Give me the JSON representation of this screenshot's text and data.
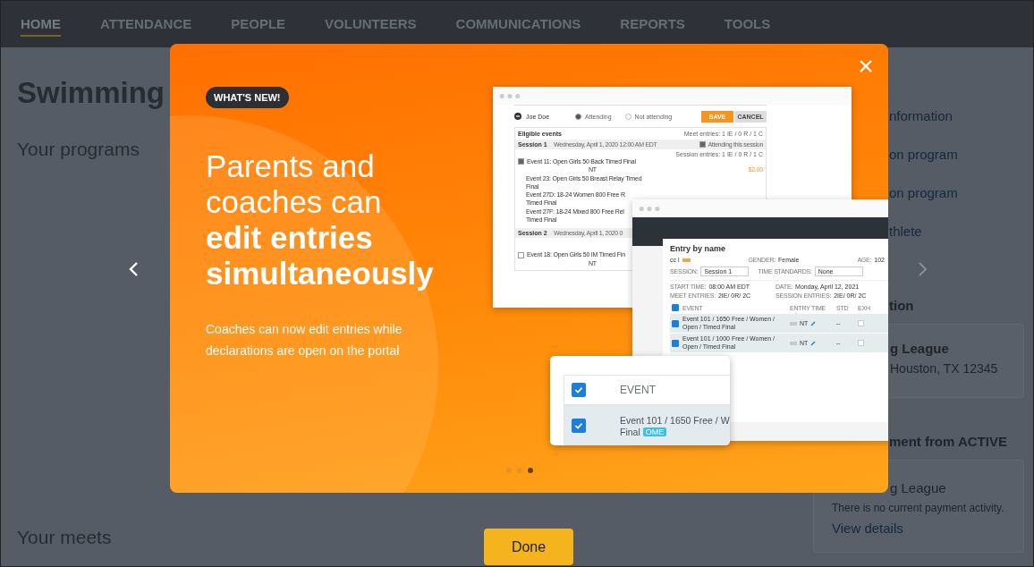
{
  "nav": [
    {
      "label": "HOME",
      "selected": true
    },
    {
      "label": "ATTENDANCE",
      "selected": false
    },
    {
      "label": "PEOPLE",
      "selected": false
    },
    {
      "label": "VOLUNTEERS",
      "selected": false
    },
    {
      "label": "COMMUNICATIONS",
      "selected": false
    },
    {
      "label": "REPORTS",
      "selected": false
    },
    {
      "label": "TOOLS",
      "selected": false
    }
  ],
  "page": {
    "title": "Swimming",
    "programs_heading": "Your programs",
    "meets_heading": "Your meets"
  },
  "sidebar": {
    "links": [
      "nformation",
      "on program",
      "on program",
      "thlete"
    ],
    "location_heading": "tion",
    "location_card": {
      "name": "g League",
      "address": "Houston, TX 12345"
    },
    "payment_heading": "ment from ACTIVE",
    "payment_card": {
      "name": "g League",
      "status": "There is no current payment activity.",
      "link": "View details"
    }
  },
  "modal": {
    "badge": "WHAT'S NEW!",
    "headline": "Parents and coaches can **edit entries simultaneously**",
    "description": "Coaches can now edit entries while declarations are open on the portal",
    "slides": [
      {
        "selected": false
      },
      {
        "selected": false
      },
      {
        "selected": true
      }
    ],
    "done_label": "Done"
  },
  "declaration_mockup": {
    "athlete": "Joe Doe",
    "options": [
      {
        "label": "Attending",
        "selected": true
      },
      {
        "label": "Not attending",
        "selected": false
      }
    ],
    "save_label": "SAVE",
    "cancel_label": "CANCEL",
    "events_title": "Eligible events",
    "meet_entries": "Meet entries: 1 IE / 0 R / 1 C",
    "sessions": [
      {
        "name": "Session 1",
        "date": "Wednesday, April 1, 2020 12:00 AM EDT",
        "attending_label": "Attending this session",
        "attending": true,
        "entries": "Session entries: 1 IE / 0 R / 1 C",
        "events": [
          {
            "kind": "checkbox",
            "label": "Event 11: Open Girls 50 Back Timed Final",
            "checked": true,
            "time": "NT",
            "fee": "$2.00"
          },
          {
            "kind": "plain",
            "label": "Event 23: Open Girls 50 Breast Relay Timed",
            "line2": "Final"
          },
          {
            "kind": "plain",
            "label": "Event 27D: 18-24 Women 800 Free R",
            "line2": "Timed Final"
          },
          {
            "kind": "plain",
            "label": "Event 27F: 18-24 Mixed 800 Free Rel",
            "line2": "Timed Final"
          }
        ]
      },
      {
        "name": "Session 2",
        "date": "Wednesday, April 1, 2020 0",
        "events": [
          {
            "kind": "checkbox",
            "label": "Event 18: Open Girls 50 IM Timed Fin",
            "checked": false,
            "time": "NT"
          }
        ]
      }
    ]
  },
  "entry_mockup": {
    "title": "Entry by name",
    "athlete": "cc l",
    "gender_label": "GENDER:",
    "gender": "Female",
    "age_label": "AGE:",
    "age": "102",
    "selects": [
      {
        "label": "SESSION:",
        "value": "Session 1"
      },
      {
        "label": "TIME STANDARDS:",
        "value": "None"
      }
    ],
    "info": [
      {
        "label": "START TIME:",
        "value": "08:00 AM EDT"
      },
      {
        "label": "DATE:",
        "value": "Monday, April 12, 2021"
      },
      {
        "label": "MEET ENTRIES:",
        "value": "2IE/ 0R/ 2C"
      },
      {
        "label": "SESSION ENTRIES:",
        "value": "2IE/ 0R/ 2C"
      }
    ],
    "header_checked": true,
    "columns": [
      "EVENT",
      "ENTRY TIME",
      "STD",
      "EXH"
    ],
    "rows": [
      {
        "event": "Event 101 / 1650 Free / Women / Open / Timed Final",
        "time": "NT",
        "std": "--",
        "checked": true,
        "exh": false
      },
      {
        "event": "Event 101 / 1000 Free / Women / Open / Timed Final",
        "time": "NT",
        "std": "--",
        "checked": true,
        "exh": false
      }
    ]
  },
  "event_card": {
    "header_checked": true,
    "column": "EVENT",
    "row": {
      "checked": true,
      "event": "Event 101 / 1650 Free / W",
      "line2": "Final",
      "tag": "OME"
    }
  }
}
